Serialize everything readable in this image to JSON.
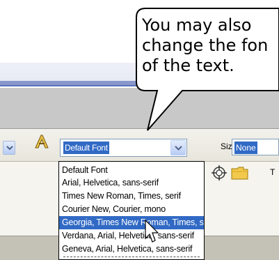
{
  "callout": {
    "line1": "You may also",
    "line2": "change the fon",
    "line3": "of the text."
  },
  "toolbar": {
    "font_select_value": "Default Font",
    "size_label": "Size",
    "size_value": "None"
  },
  "font_list": {
    "items": [
      "Default Font",
      "Arial, Helvetica, sans-serif",
      "Times New Roman, Times, serif",
      "Courier New, Courier, mono",
      "Georgia, Times New Roman, Times, serif",
      "Verdana, Arial, Helvetica, sans-serif",
      "Geneva, Arial, Helvetica, sans-serif"
    ],
    "selected_index": 4
  },
  "side_text": "T",
  "icons": {
    "font_color": "font-color-icon",
    "anchor": "anchor-icon",
    "folder": "folder-icon",
    "cursor": "mouse-cursor-icon"
  },
  "colors": {
    "selection": "#316ac5",
    "accent_line": "#5a72b8"
  }
}
